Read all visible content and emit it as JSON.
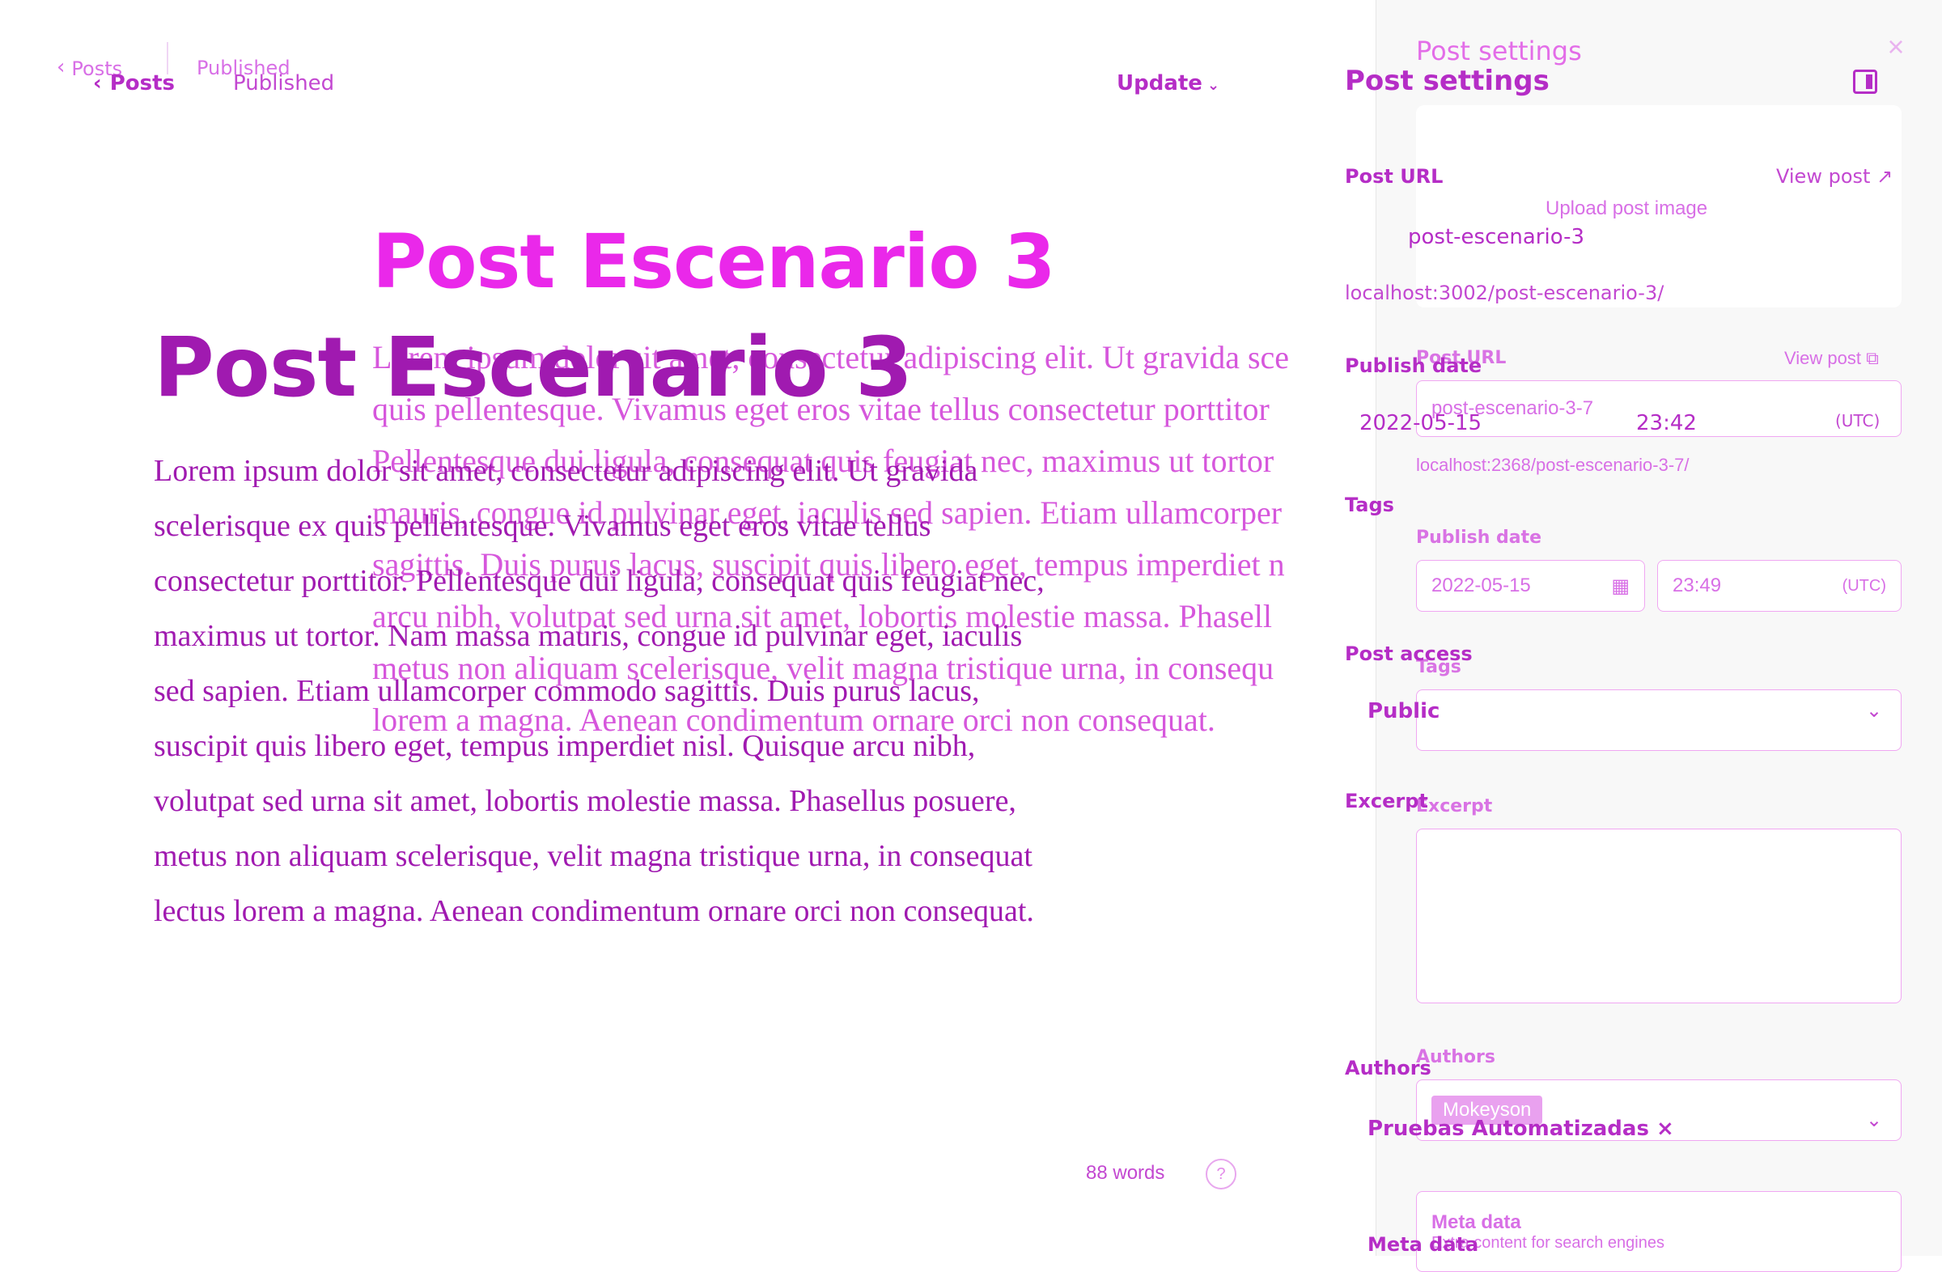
{
  "header": {
    "back_label": "Posts",
    "status": "Published",
    "update_label": "Update"
  },
  "post": {
    "title": "Post Escenario 3",
    "body_lines": [
      "Lorem ipsum dolor sit amet, consectetur adipiscing elit. Ut gravida",
      "scelerisque ex quis pellentesque. Vivamus eget eros vitae tellus",
      "consectetur porttitor. Pellentesque dui ligula, consequat quis feugiat nec,",
      "maximus ut tortor. Nam massa mauris, congue id pulvinar eget, iaculis",
      "sed sapien. Etiam ullamcorper commodo sagittis. Duis purus lacus,",
      "suscipit quis libero eget, tempus imperdiet nisl. Quisque arcu nibh,",
      "volutpat sed urna sit amet, lobortis molestie massa. Phasellus posuere,",
      "metus non aliquam scelerisque, velit magna tristique urna, in consequat",
      "lectus lorem a magna. Aenean condimentum ornare orci non consequat."
    ],
    "body_lines_back": [
      "Lorem ipsum dolor sit amet, consectetur adipiscing elit. Ut gravida sce",
      "quis pellentesque. Vivamus eget eros vitae tellus consectetur porttitor",
      "Pellentesque dui ligula, consequat quis feugiat nec, maximus ut tortor",
      "mauris, congue id pulvinar eget, iaculis sed sapien. Etiam ullamcorper",
      "sagittis. Duis purus lacus, suscipit quis libero eget, tempus imperdiet n",
      "arcu nibh, volutpat sed urna sit amet, lobortis molestie massa. Phasell",
      "metus non aliquam scelerisque, velit magna tristique urna, in consequ",
      "lorem a magna. Aenean condimentum ornare orci non consequat."
    ],
    "word_count": "88 words",
    "help_icon": "?"
  },
  "settings": {
    "title": "Post settings",
    "upload_label": "Upload post image",
    "post_url_label": "Post URL",
    "view_post_label": "View post",
    "slug": "post-escenario-3",
    "url_preview": "localhost:3002/post-escenario-3/",
    "publish_date_label": "Publish date",
    "date": "2022-05-15",
    "time": "23:42",
    "timezone": "(UTC)",
    "tags_label": "Tags",
    "post_access_label": "Post access",
    "access_value": "Public",
    "excerpt_label": "Excerpt",
    "authors_label": "Authors",
    "author_name": "Pruebas Automatizadas",
    "author_remove": "×",
    "meta_label": "Meta data",
    "meta_desc": "Extra content for search engines"
  },
  "settings_back": {
    "title": "Post settings",
    "close_icon": "×",
    "post_url_label": "Post URL",
    "view_post_label": "View post",
    "slug": "post-escenario-3-7",
    "url_preview": "localhost:2368/post-escenario-3-7/",
    "publish_date_label": "Publish date",
    "date": "2022-05-15",
    "time": "23:49",
    "timezone": "(UTC)",
    "tags_label": "Tags",
    "excerpt_label": "Excerpt",
    "authors_label": "Authors",
    "author_name": "Mokeyson",
    "meta_label": "Meta data",
    "meta_desc": "Extra content for search engines"
  },
  "colors": {
    "accent": "#b52dc6",
    "accent_light": "#e36de8",
    "panel_bg": "#f8f8f8"
  }
}
